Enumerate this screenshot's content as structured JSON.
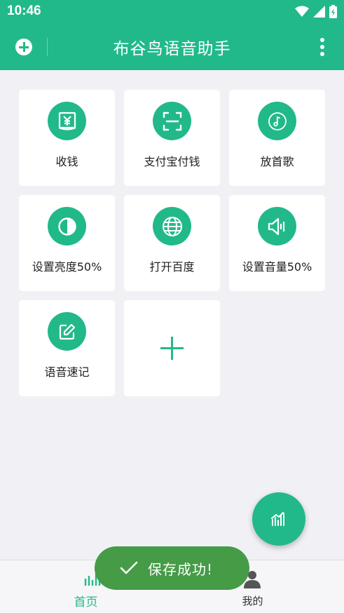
{
  "status_bar": {
    "time": "10:46"
  },
  "app_bar": {
    "title": "布谷鸟语音助手"
  },
  "grid": {
    "items": [
      {
        "label": "收钱",
        "icon": "yen-book-icon"
      },
      {
        "label": "支付宝付钱",
        "icon": "scan-icon"
      },
      {
        "label": "放首歌",
        "icon": "music-note-icon"
      },
      {
        "label": "设置亮度50%",
        "icon": "brightness-icon"
      },
      {
        "label": "打开百度",
        "icon": "globe-icon"
      },
      {
        "label": "设置音量50%",
        "icon": "volume-icon"
      },
      {
        "label": "语音速记",
        "icon": "edit-note-icon"
      }
    ],
    "add_tile_icon": "plus-icon"
  },
  "bottom_nav": {
    "home_label": "首页",
    "me_label": "我的"
  },
  "toast": {
    "text": "保存成功!"
  },
  "colors": {
    "primary": "#22b98a",
    "toast_bg": "#469b47",
    "background": "#f1f1f5"
  }
}
